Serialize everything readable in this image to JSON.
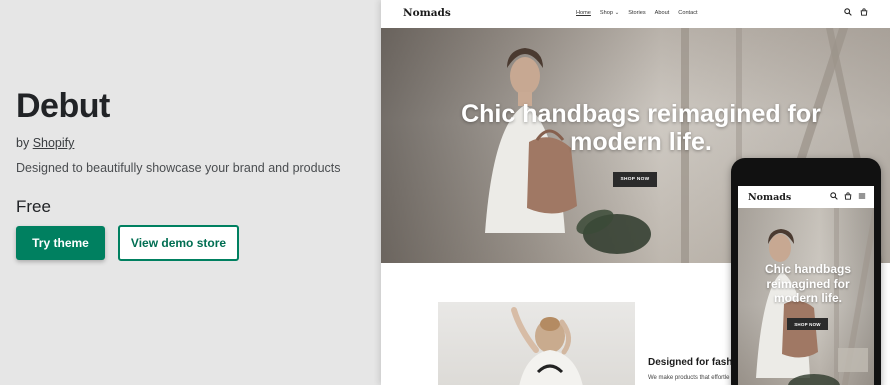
{
  "theme": {
    "name": "Debut",
    "by_prefix": "by",
    "author": "Shopify",
    "description": "Designed to beautifully showcase your brand and products",
    "price": "Free",
    "try_label": "Try theme",
    "demo_label": "View demo store"
  },
  "colors": {
    "brand_green": "#008060",
    "panel_bg": "#e6e6e6"
  },
  "desktop_preview": {
    "store_name": "Nomads",
    "nav": [
      "Home",
      "Shop",
      "Stories",
      "About",
      "Contact"
    ],
    "shop_dropdown_glyph": "⌄",
    "icons": [
      "search-icon",
      "cart-icon"
    ],
    "hero_title": "Chic handbags reimagined for modern life.",
    "hero_button": "SHOP NOW",
    "section_heading": "Designed for fashio",
    "section_body": "We make products that effortle"
  },
  "mobile_preview": {
    "store_name": "Nomads",
    "icons": [
      "search-icon",
      "cart-icon",
      "menu-icon"
    ],
    "hero_title": "Chic handbags reimagined for modern life.",
    "hero_button": "SHOP NOW"
  }
}
